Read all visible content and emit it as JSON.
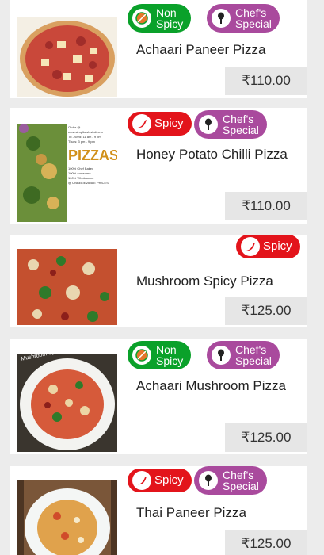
{
  "colors": {
    "non_spicy_badge": "#0aa12a",
    "spicy_badge": "#e3141b",
    "chefs_special_badge": "#a94a9d",
    "price_bg": "#e6e6e6"
  },
  "items": [
    {
      "name": "Achaari Paneer Pizza",
      "price": "₹110.00",
      "badges": [
        {
          "line1": "Non",
          "line2": "Spicy",
          "icon": "no-chilli-icon"
        },
        {
          "line1": "Chef's",
          "line2": "Special",
          "icon": "chef-spoon-icon"
        }
      ]
    },
    {
      "name": "Honey Potato Chilli Pizza",
      "price": "₹110.00",
      "badges": [
        {
          "label": "Spicy",
          "icon": "chilli-icon"
        },
        {
          "line1": "Chef's",
          "line2": "Special",
          "icon": "chef-spoon-icon"
        }
      ],
      "poster": {
        "order_text": "Order @",
        "site": "www.simplkashistaties.in",
        "hours_1": "Tu - Wed: 11 am - 9 pm",
        "hours_2": "Thurs: 3 pm - 9 pm",
        "title": "PIZZAS",
        "line_1": "100% Chef Baked",
        "line_2": "100% Awesome",
        "line_3": "100% Wholesome",
        "line_4": "@ UNBELIEVABLE PRICES!"
      }
    },
    {
      "name": "Mushroom Spicy Pizza",
      "price": "₹125.00",
      "badges": [
        {
          "label": "Spicy",
          "icon": "chilli-icon"
        }
      ]
    },
    {
      "name": "Achaari Mushroom Pizza",
      "price": "₹125.00",
      "badges": [
        {
          "line1": "Non",
          "line2": "Spicy",
          "icon": "no-chilli-icon"
        },
        {
          "line1": "Chef's",
          "line2": "Special",
          "icon": "chef-spoon-icon"
        }
      ],
      "photo_caption": "Mushroom Spicy Pizza"
    },
    {
      "name": "Thai Paneer Pizza",
      "price": "₹125.00",
      "badges": [
        {
          "label": "Spicy",
          "icon": "chilli-icon"
        },
        {
          "line1": "Chef's",
          "line2": "Special",
          "icon": "chef-spoon-icon"
        }
      ]
    }
  ]
}
